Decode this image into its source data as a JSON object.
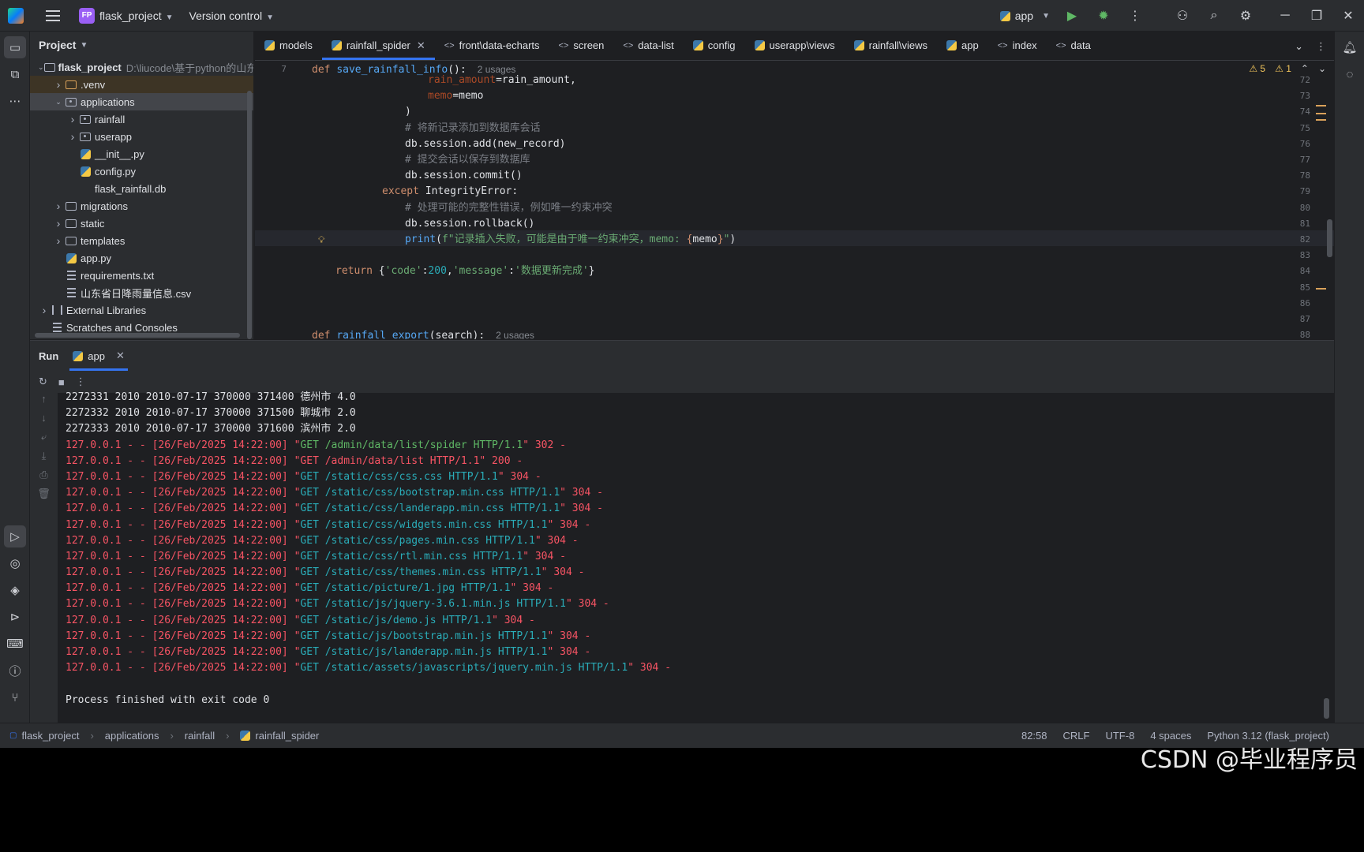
{
  "titlebar": {
    "project_badge": "FP",
    "project_name": "flask_project",
    "vcs": "Version control",
    "run_config": "app"
  },
  "project_panel": {
    "title": "Project",
    "tree": [
      {
        "label": "flask_project",
        "hint": "D:\\liucode\\基于python的山东省",
        "depth": 0,
        "type": "folder",
        "expanded": true
      },
      {
        "label": ".venv",
        "depth": 1,
        "type": "folder-orange",
        "expanded": false
      },
      {
        "label": "applications",
        "depth": 1,
        "type": "package",
        "expanded": true
      },
      {
        "label": "rainfall",
        "depth": 2,
        "type": "package",
        "expanded": false
      },
      {
        "label": "userapp",
        "depth": 2,
        "type": "package",
        "expanded": false
      },
      {
        "label": "__init__.py",
        "depth": 2,
        "type": "python"
      },
      {
        "label": "config.py",
        "depth": 2,
        "type": "python"
      },
      {
        "label": "flask_rainfall.db",
        "depth": 2,
        "type": "db"
      },
      {
        "label": "migrations",
        "depth": 1,
        "type": "folder",
        "expanded": false
      },
      {
        "label": "static",
        "depth": 1,
        "type": "folder",
        "expanded": false
      },
      {
        "label": "templates",
        "depth": 1,
        "type": "folder",
        "expanded": false
      },
      {
        "label": "app.py",
        "depth": 1,
        "type": "python"
      },
      {
        "label": "requirements.txt",
        "depth": 1,
        "type": "text"
      },
      {
        "label": "山东省日降雨量信息.csv",
        "depth": 1,
        "type": "text"
      },
      {
        "label": "External Libraries",
        "depth": 0,
        "type": "library",
        "expanded": false
      },
      {
        "label": "Scratches and Consoles",
        "depth": 0,
        "type": "scratch"
      }
    ]
  },
  "tabs": [
    {
      "label": "models",
      "icon": "python"
    },
    {
      "label": "rainfall_spider",
      "icon": "python",
      "active": true
    },
    {
      "label": "front\\data-echarts",
      "icon": "html"
    },
    {
      "label": "screen",
      "icon": "html"
    },
    {
      "label": "data-list",
      "icon": "html"
    },
    {
      "label": "config",
      "icon": "python"
    },
    {
      "label": "userapp\\views",
      "icon": "python"
    },
    {
      "label": "rainfall\\views",
      "icon": "python"
    },
    {
      "label": "app",
      "icon": "python"
    },
    {
      "label": "index",
      "icon": "html"
    },
    {
      "label": "data",
      "icon": "html"
    }
  ],
  "editor": {
    "warnings": "5",
    "weak_warnings": "1",
    "sticky_line_no": "7",
    "sticky_usages": "2 usages",
    "lines": [
      {
        "no": "72",
        "text": "rain_amount=rain_amount,"
      },
      {
        "no": "73",
        "text": "memo=memo"
      },
      {
        "no": "74",
        "text": ")"
      },
      {
        "no": "75",
        "text": "# 将新记录添加到数据库会话"
      },
      {
        "no": "76",
        "text": "db.session.add(new_record)"
      },
      {
        "no": "77",
        "text": "# 提交会话以保存到数据库"
      },
      {
        "no": "78",
        "text": "db.session.commit()"
      },
      {
        "no": "79",
        "text": "except IntegrityError:"
      },
      {
        "no": "80",
        "text": "# 处理可能的完整性错误，例如唯一约束冲突"
      },
      {
        "no": "81",
        "text": "db.session.rollback()"
      },
      {
        "no": "82",
        "text": "print(f\"记录插入失败，可能是由于唯一约束冲突，memo: {memo}\")"
      },
      {
        "no": "83",
        "text": ""
      },
      {
        "no": "84",
        "text": "return {'code':200,'message':'数据更新完成'}"
      },
      {
        "no": "85",
        "text": ""
      },
      {
        "no": "86",
        "text": ""
      },
      {
        "no": "87",
        "text": ""
      },
      {
        "no": "88",
        "text": "def rainfall_export(search):"
      }
    ],
    "sticky_def": "def save_rainfall_info():",
    "export_usages": "2 usages"
  },
  "run_panel": {
    "title": "Run",
    "tab": "app",
    "output": [
      {
        "text": "2272331 2010 2010-07-17 370000 371400 德州市 4.0",
        "style": "white"
      },
      {
        "text": "2272332 2010 2010-07-17 370000 371500 聊城市 2.0",
        "style": "white"
      },
      {
        "text": "2272333 2010 2010-07-17 370000 371600 滨州市 2.0",
        "style": "white"
      },
      {
        "prefix": "127.0.0.1 - - [26/Feb/2025 14:22:00] \"",
        "req": "GET /admin/data/list/spider HTTP/1.1",
        "suffix": "\" 302 -",
        "style": "green"
      },
      {
        "prefix": "127.0.0.1 - - [26/Feb/2025 14:22:00] \"",
        "req": "GET /admin/data/list HTTP/1.1",
        "suffix": "\" 200 -",
        "style": "plain"
      },
      {
        "prefix": "127.0.0.1 - - [26/Feb/2025 14:22:00] \"",
        "req": "GET /static/css/css.css HTTP/1.1",
        "suffix": "\" 304 -",
        "style": "cyan"
      },
      {
        "prefix": "127.0.0.1 - - [26/Feb/2025 14:22:00] \"",
        "req": "GET /static/css/bootstrap.min.css HTTP/1.1",
        "suffix": "\" 304 -",
        "style": "cyan"
      },
      {
        "prefix": "127.0.0.1 - - [26/Feb/2025 14:22:00] \"",
        "req": "GET /static/css/landerapp.min.css HTTP/1.1",
        "suffix": "\" 304 -",
        "style": "cyan"
      },
      {
        "prefix": "127.0.0.1 - - [26/Feb/2025 14:22:00] \"",
        "req": "GET /static/css/widgets.min.css HTTP/1.1",
        "suffix": "\" 304 -",
        "style": "cyan"
      },
      {
        "prefix": "127.0.0.1 - - [26/Feb/2025 14:22:00] \"",
        "req": "GET /static/css/pages.min.css HTTP/1.1",
        "suffix": "\" 304 -",
        "style": "cyan"
      },
      {
        "prefix": "127.0.0.1 - - [26/Feb/2025 14:22:00] \"",
        "req": "GET /static/css/rtl.min.css HTTP/1.1",
        "suffix": "\" 304 -",
        "style": "cyan"
      },
      {
        "prefix": "127.0.0.1 - - [26/Feb/2025 14:22:00] \"",
        "req": "GET /static/css/themes.min.css HTTP/1.1",
        "suffix": "\" 304 -",
        "style": "cyan"
      },
      {
        "prefix": "127.0.0.1 - - [26/Feb/2025 14:22:00] \"",
        "req": "GET /static/picture/1.jpg HTTP/1.1",
        "suffix": "\" 304 -",
        "style": "cyan"
      },
      {
        "prefix": "127.0.0.1 - - [26/Feb/2025 14:22:00] \"",
        "req": "GET /static/js/jquery-3.6.1.min.js HTTP/1.1",
        "suffix": "\" 304 -",
        "style": "cyan"
      },
      {
        "prefix": "127.0.0.1 - - [26/Feb/2025 14:22:00] \"",
        "req": "GET /static/js/demo.js HTTP/1.1",
        "suffix": "\" 304 -",
        "style": "cyan"
      },
      {
        "prefix": "127.0.0.1 - - [26/Feb/2025 14:22:00] \"",
        "req": "GET /static/js/bootstrap.min.js HTTP/1.1",
        "suffix": "\" 304 -",
        "style": "cyan"
      },
      {
        "prefix": "127.0.0.1 - - [26/Feb/2025 14:22:00] \"",
        "req": "GET /static/js/landerapp.min.js HTTP/1.1",
        "suffix": "\" 304 -",
        "style": "cyan"
      },
      {
        "prefix": "127.0.0.1 - - [26/Feb/2025 14:22:00] \"",
        "req": "GET /static/assets/javascripts/jquery.min.js HTTP/1.1",
        "suffix": "\" 304 -",
        "style": "cyan"
      },
      {
        "text": "",
        "style": "white"
      },
      {
        "text": "Process finished with exit code 0",
        "style": "white"
      }
    ]
  },
  "statusbar": {
    "breadcrumbs": [
      "flask_project",
      "applications",
      "rainfall",
      "rainfall_spider"
    ],
    "position": "82:58",
    "line_sep": "CRLF",
    "encoding": "UTF-8",
    "indent": "4 spaces",
    "interpreter": "Python 3.12 (flask_project)"
  },
  "watermark": "CSDN @毕业程序员"
}
